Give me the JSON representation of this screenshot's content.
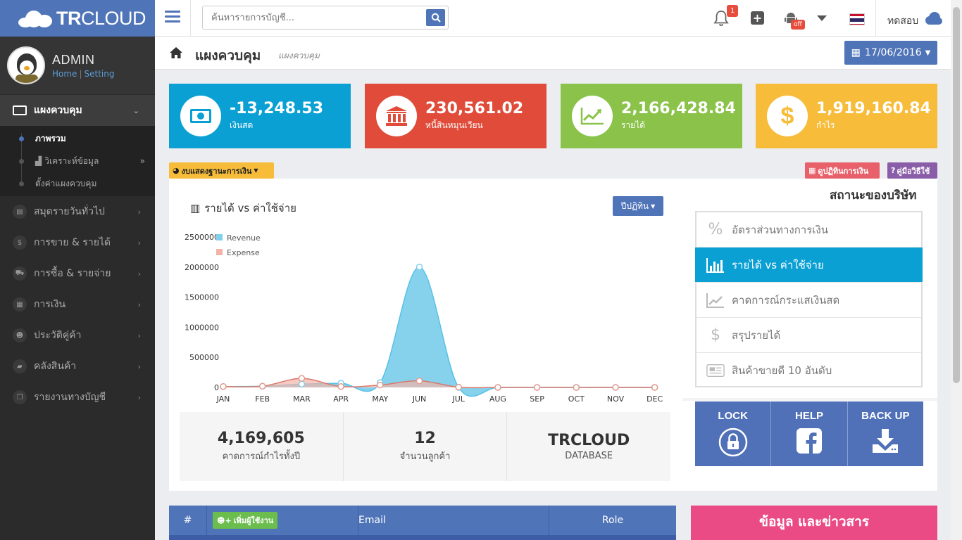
{
  "brand": {
    "bold": "TR",
    "light": "CLOUD"
  },
  "profile": {
    "name": "ADMIN",
    "home": "Home",
    "setting": "Setting"
  },
  "sidebar": {
    "active": "แผงควบคุม",
    "sub": [
      "ภาพรวม",
      "วิเคราะห์ข้อมูล",
      "ตั้งค่าแผงควบคุม"
    ],
    "items": [
      {
        "label": "สมุดรายวันทั่วไป",
        "icon": "book-icon"
      },
      {
        "label": "การขาย & รายได้",
        "icon": "dollar-icon"
      },
      {
        "label": "การซื้อ & รายจ่าย",
        "icon": "cart-icon"
      },
      {
        "label": "การเงิน",
        "icon": "calendar-icon"
      },
      {
        "label": "ประวัติคู่ค้า",
        "icon": "users-icon"
      },
      {
        "label": "คลังสินค้า",
        "icon": "truck-icon"
      },
      {
        "label": "รายงานทางบัญชี",
        "icon": "copy-icon"
      }
    ]
  },
  "topbar": {
    "search_placeholder": "ค้นหารายการบัญชี...",
    "bell_count": "1",
    "android_badge": "off",
    "user": "ทดสอบ"
  },
  "header": {
    "title": "แผงควบคุม",
    "subtitle": "แผงควบคุม",
    "date": "17/06/2016"
  },
  "stats": [
    {
      "value": "-13,248.53",
      "label": "เงินสด",
      "color": "#0aa0d4"
    },
    {
      "value": "230,561.02",
      "label": "หนี้สินหมุนเวียน",
      "color": "#e04b3a"
    },
    {
      "value": "2,166,428.84",
      "label": "รายได้",
      "color": "#8bc34a"
    },
    {
      "value": "1,919,160.84",
      "label": "กำไร",
      "color": "#f7bc3a"
    }
  ],
  "tags": {
    "statement": "งบแสดงฐานะการเงิน",
    "calendar": "ดูปฏิทินการเงิน",
    "manual": "คู่มือวิธีใช้"
  },
  "chart": {
    "title": "รายได้ vs ค่าใช้จ่าย",
    "button": "ปีปฏิทิน"
  },
  "chart_data": {
    "type": "area",
    "categories": [
      "JAN",
      "FEB",
      "MAR",
      "APR",
      "MAY",
      "JUN",
      "JUL",
      "AUG",
      "SEP",
      "OCT",
      "NOV",
      "DEC"
    ],
    "series": [
      {
        "name": "Revenue",
        "color": "#7fd0ec",
        "values": [
          15000,
          20000,
          55000,
          70000,
          80000,
          2000000,
          0,
          0,
          0,
          0,
          0,
          0
        ]
      },
      {
        "name": "Expense",
        "color": "#f2b3a8",
        "values": [
          15000,
          20000,
          150000,
          15000,
          40000,
          110000,
          5000,
          0,
          0,
          0,
          0,
          0
        ]
      }
    ],
    "yticks": [
      "2500000",
      "2000000",
      "1500000",
      "1000000",
      "500000",
      "0"
    ],
    "ylim": [
      0,
      2500000
    ]
  },
  "summary": [
    {
      "big": "4,169,605",
      "small": "คาดการณ์กำไรทั้งปี"
    },
    {
      "big": "12",
      "small": "จำนวนลูกค้า"
    },
    {
      "big": "TRCLOUD",
      "small": "DATABASE"
    }
  ],
  "status": {
    "title": "สถานะของบริษัท",
    "items": [
      {
        "label": "อัตราส่วนทางการเงิน",
        "icon": "percent-icon"
      },
      {
        "label": "รายได้ vs ค่าใช้จ่าย",
        "icon": "bar-chart-icon"
      },
      {
        "label": "คาดการณ์กระแสเงินสด",
        "icon": "line-chart-icon"
      },
      {
        "label": "สรุปรายได้",
        "icon": "dollar-icon"
      },
      {
        "label": "สินค้าขายดี 10 อันดับ",
        "icon": "newspaper-icon"
      }
    ]
  },
  "actions": [
    {
      "label": "LOCK"
    },
    {
      "label": "HELP"
    },
    {
      "label": "BACK UP"
    }
  ],
  "table": {
    "hash": "#",
    "add_user": "เพิ่มผู้ใช้งาน",
    "email": "Email",
    "role": "Role"
  },
  "news": "ข้อมูล และข่าวสาร"
}
